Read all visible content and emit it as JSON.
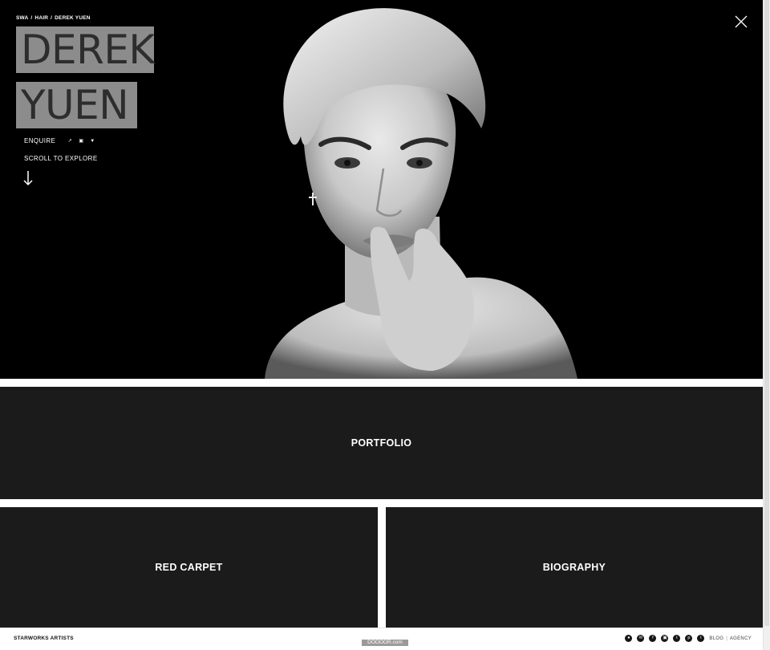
{
  "hero": {
    "breadcrumb": [
      "SWA",
      "HAIR",
      "DEREK YUEN"
    ],
    "breadcrumb_sep": "/",
    "name_line1": "DEREK",
    "name_line2": "YUEN",
    "enquire_label": "ENQUIRE",
    "social_icons": [
      "link-icon",
      "instagram-icon",
      "twitter-icon"
    ],
    "scroll_label": "SCROLL TO EXPLORE",
    "close_icon": "close-icon"
  },
  "tiles": {
    "portfolio": "PORTFOLIO",
    "red_carpet": "RED CARPET",
    "biography": "BIOGRAPHY"
  },
  "footer": {
    "brand": "STARWORKS ARTISTS",
    "watermark": "DOOOOR.com",
    "social_icons": [
      "website-icon",
      "email-icon",
      "facebook-icon",
      "instagram-icon",
      "twitter-icon",
      "pinterest-icon",
      "tumblr-icon"
    ],
    "blog_label": "BLOG",
    "separator": "|",
    "agency_label": "AGENCY"
  },
  "colors": {
    "tile_bg": "#1b1b1b",
    "name_block_bg": "#8c8c8c",
    "name_text": "#2d2d2d"
  }
}
